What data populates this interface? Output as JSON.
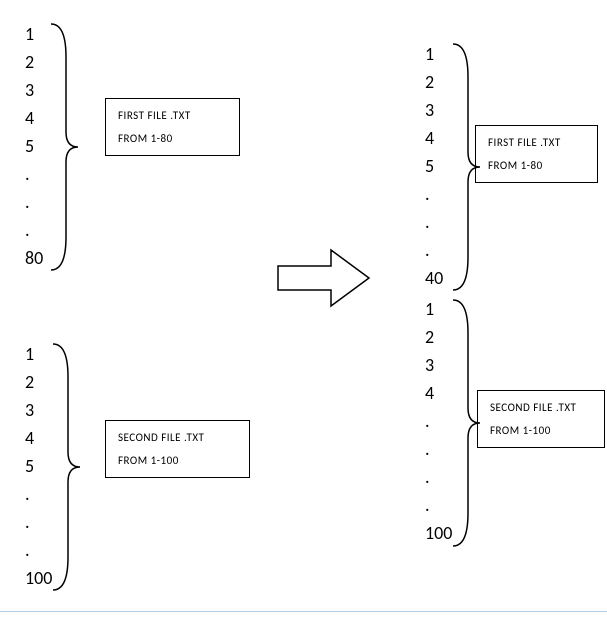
{
  "left_first": {
    "items": [
      "1",
      "2",
      "3",
      "4",
      "5",
      ".",
      ".",
      ".",
      "80"
    ],
    "box_line1": "FIRST FILE .TXT",
    "box_line2": "FROM 1-80"
  },
  "left_second": {
    "items": [
      "1",
      "2",
      "3",
      "4",
      "5",
      ".",
      ".",
      ".",
      "100"
    ],
    "box_line1": "SECOND  FILE .TXT",
    "box_line2": "FROM 1-100"
  },
  "right_first": {
    "items": [
      "1",
      "2",
      "3",
      "4",
      "5",
      ".",
      ".",
      ".",
      "40"
    ],
    "box_line1": "FIRST FILE .TXT",
    "box_line2": "FROM 1-80"
  },
  "right_second": {
    "items": [
      "1",
      "2",
      "3",
      "4",
      ".",
      ".",
      ".",
      ".",
      "100"
    ],
    "box_line1": "SECOND  FILE .TXT",
    "box_line2": "FROM 1-100"
  }
}
